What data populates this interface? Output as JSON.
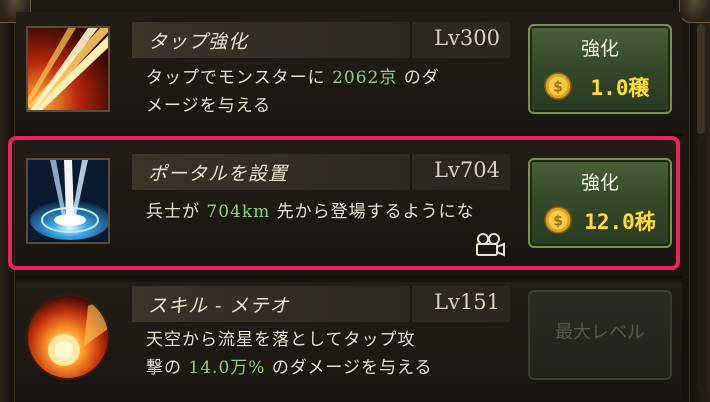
{
  "rows": [
    {
      "title": "タップ強化",
      "level": "Lv300",
      "desc_line1_pre": "タップでモンスターに ",
      "desc_line1_value": "2062京",
      "desc_line1_post": " のダ",
      "desc_line2": "メージを与える",
      "button_label": "強化",
      "price": "1.0穣",
      "icon": "tap-slash-icon"
    },
    {
      "title": "ポータルを設置",
      "level": "Lv704",
      "desc_line1_pre": "兵士が ",
      "desc_line1_value": "704km",
      "desc_line1_post": " 先から登場するようにな",
      "desc_line2": "",
      "button_label": "強化",
      "price": "12.0秭",
      "icon": "portal-icon",
      "video_icon": "video-camera-icon"
    },
    {
      "title": "スキル - メテオ",
      "level": "Lv151",
      "desc_line1": "天空から流星を落としてタップ攻",
      "desc_line2_pre": "撃の ",
      "desc_line2_value": "14.0万%",
      "desc_line2_post": " のダメージを与える",
      "button_label": "最大レベル",
      "icon": "meteor-icon"
    }
  ],
  "colors": {
    "highlight": "#f0205a",
    "value_green": "#8fd07a",
    "price_yellow": "#ffdc3a",
    "button_green": "#34482a"
  }
}
